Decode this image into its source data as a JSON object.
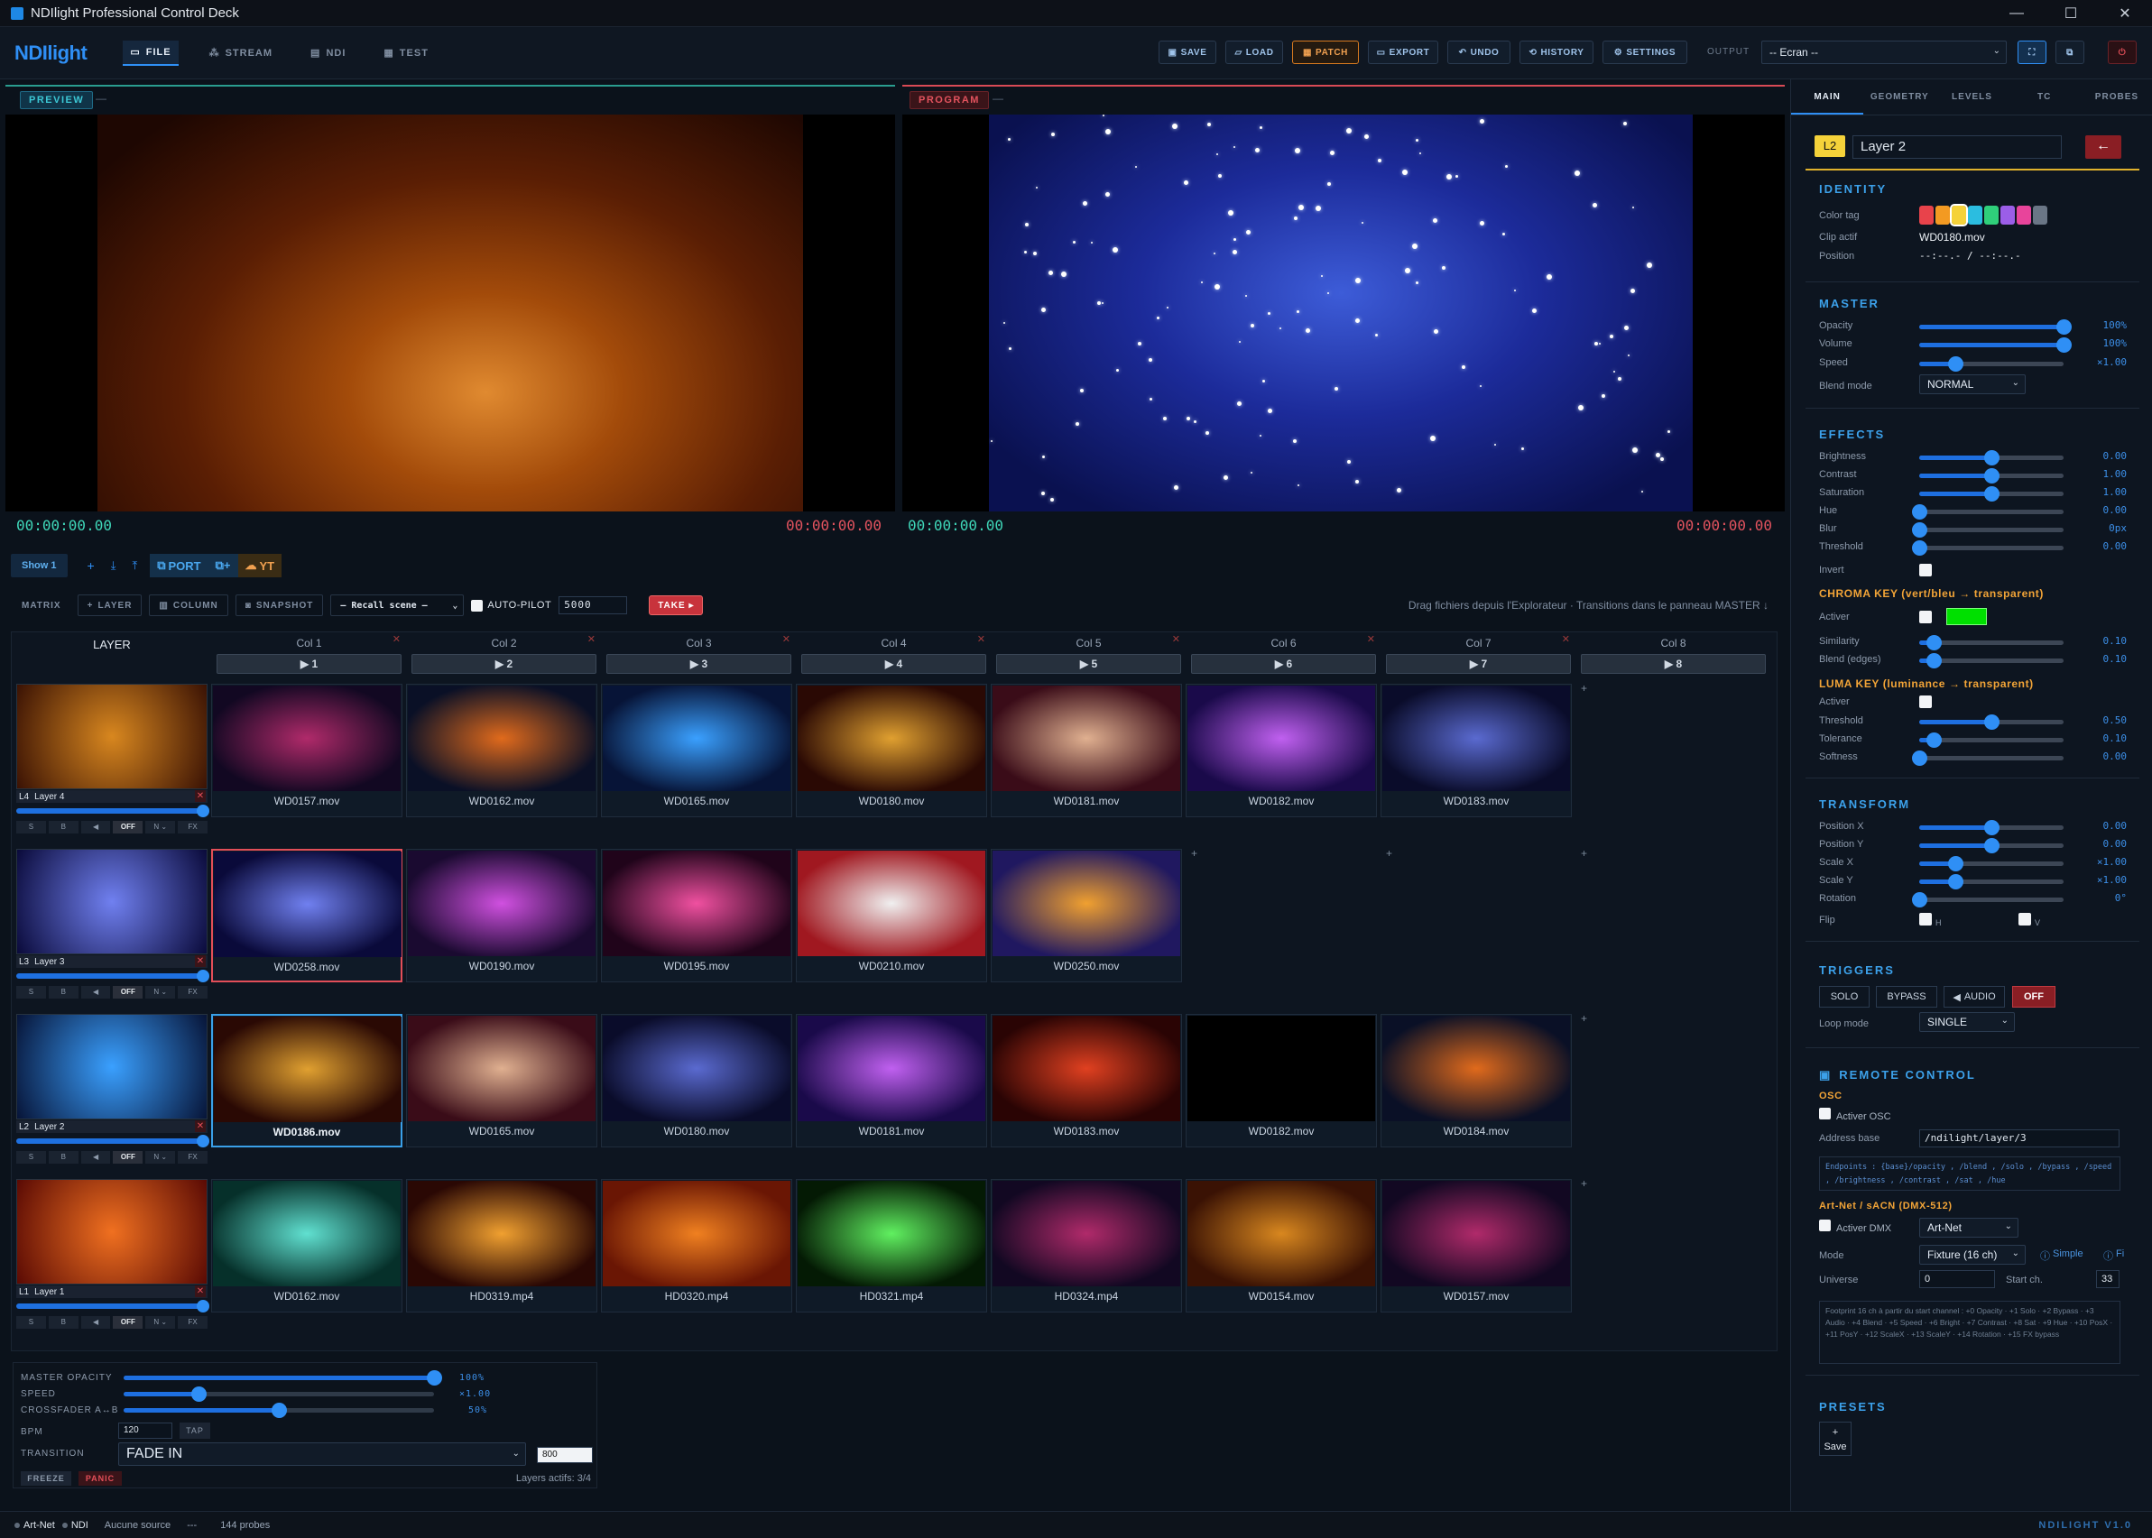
{
  "window": {
    "title": "NDIlight Professional Control Deck"
  },
  "menubar": {
    "logo": "NDIlight",
    "tabs": [
      {
        "label": "FILE",
        "icon": "file-icon"
      },
      {
        "label": "STREAM",
        "icon": "stream-icon"
      },
      {
        "label": "NDI",
        "icon": "ndi-icon"
      },
      {
        "label": "TEST",
        "icon": "test-icon"
      }
    ],
    "tools": [
      "SAVE",
      "LOAD",
      "PATCH",
      "EXPORT",
      "UNDO",
      "HISTORY",
      "SETTINGS"
    ],
    "output_label": "OUTPUT",
    "output_value": "-- Ecran --"
  },
  "preview": {
    "label": "PREVIEW",
    "dash": "—",
    "tc_left": "00:00:00.00",
    "tc_right": "00:00:00.00"
  },
  "program": {
    "label": "PROGRAM",
    "dash": "—",
    "tc_left": "00:00:00.00",
    "tc_right": "00:00:00.00"
  },
  "showbar": {
    "show": "Show 1",
    "port": "PORT",
    "yt": "YT"
  },
  "matrixbar": {
    "title": "MATRIX",
    "layer": "LAYER",
    "column": "COLUMN",
    "snapshot": "SNAPSHOT",
    "recall": "– Recall scene –",
    "autopilot": "AUTO-PILOT",
    "autopilot_value": "5000",
    "take": "TAKE ▸",
    "hint": "Drag fichiers depuis l'Explorateur · Transitions dans le panneau MASTER ↓"
  },
  "grid": {
    "layer_header": "LAYER",
    "columns": [
      {
        "name": "Col 1",
        "play": "▶ 1"
      },
      {
        "name": "Col 2",
        "play": "▶ 2"
      },
      {
        "name": "Col 3",
        "play": "▶ 3"
      },
      {
        "name": "Col 4",
        "play": "▶ 4"
      },
      {
        "name": "Col 5",
        "play": "▶ 5"
      },
      {
        "name": "Col 6",
        "play": "▶ 6"
      },
      {
        "name": "Col 7",
        "play": "▶ 7"
      },
      {
        "name": "Col 8",
        "play": "▶ 8"
      }
    ],
    "layers": [
      {
        "id": "L4",
        "name": "Layer 4",
        "btns": [
          "S",
          "B",
          "◀",
          "OFF",
          "N ⌄",
          "FX"
        ],
        "clips": [
          "WD0157.mov",
          "WD0162.mov",
          "WD0165.mov",
          "WD0180.mov",
          "WD0181.mov",
          "WD0182.mov",
          "WD0183.mov"
        ]
      },
      {
        "id": "L3",
        "name": "Layer 3",
        "btns": [
          "S",
          "B",
          "◀",
          "OFF",
          "N ⌄",
          "FX"
        ],
        "clips": [
          "WD0258.mov",
          "WD0190.mov",
          "WD0195.mov",
          "WD0210.mov",
          "WD0250.mov"
        ]
      },
      {
        "id": "L2",
        "name": "Layer 2",
        "btns": [
          "S",
          "B",
          "◀",
          "OFF",
          "N ⌄",
          "FX"
        ],
        "clips": [
          "WD0186.mov",
          "WD0165.mov",
          "WD0180.mov",
          "WD0181.mov",
          "WD0183.mov",
          "WD0182.mov",
          "WD0184.mov"
        ]
      },
      {
        "id": "L1",
        "name": "Layer 1",
        "btns": [
          "S",
          "B",
          "◀",
          "OFF",
          "N ⌄",
          "FX"
        ],
        "clips": [
          "WD0162.mov",
          "HD0319.mp4",
          "HD0320.mp4",
          "HD0321.mp4",
          "HD0324.mp4",
          "WD0154.mov",
          "WD0157.mov"
        ]
      }
    ]
  },
  "master": {
    "opacity_label": "MASTER OPACITY",
    "opacity_value": "100%",
    "opacity_level": 1.0,
    "speed_label": "SPEED",
    "speed_value": "×1.00",
    "speed_level": 0.24,
    "crossfader_label": "CROSSFADER A↔B",
    "crossfader_value": "50%",
    "crossfader_level": 0.5,
    "bpm_label": "BPM",
    "bpm_value": "120",
    "tap": "TAP",
    "transition_label": "TRANSITION",
    "transition_value": "FADE IN",
    "transition_ms": "800",
    "freeze": "FREEZE",
    "panic": "PANIC",
    "layers_active": "Layers actifs: 3/4"
  },
  "status": {
    "artnet": "Art-Net",
    "ndi": "NDI",
    "source": "Aucune source",
    "sep": "---",
    "probes": "144 probes",
    "version": "NDILIGHT V1.0"
  },
  "panel": {
    "tabs": [
      "MAIN",
      "GEOMETRY",
      "LEVELS",
      "TC",
      "PROBES"
    ],
    "layer_badge": "L2",
    "layer_name": "Layer 2",
    "identity": {
      "title": "IDENTITY",
      "color_tag": "Color tag",
      "clip_label": "Clip actif",
      "clip": "WD0180.mov",
      "position_label": "Position",
      "position": "--:--.- / --:--.-"
    },
    "colors": [
      "#e8434b",
      "#f39a22",
      "#f5d23a",
      "#2bbde0",
      "#2fcf7a",
      "#9b5ee8",
      "#e8449b",
      "#6a7686"
    ],
    "master": {
      "title": "MASTER",
      "opacity": "Opacity",
      "opacity_v": "100%",
      "volume": "Volume",
      "volume_v": "100%",
      "speed": "Speed",
      "speed_v": "×1.00",
      "blend": "Blend mode",
      "blend_v": "NORMAL"
    },
    "effects": {
      "title": "EFFECTS",
      "rows": [
        [
          "Brightness",
          "0.00"
        ],
        [
          "Contrast",
          "1.00"
        ],
        [
          "Saturation",
          "1.00"
        ],
        [
          "Hue",
          "0.00"
        ],
        [
          "Blur",
          "0px"
        ],
        [
          "Threshold",
          "0.00"
        ]
      ],
      "invert": "Invert"
    },
    "chroma": {
      "title": "CHROMA KEY (vert/bleu → transparent)",
      "activer": "Activer",
      "similarity": "Similarity",
      "similarity_v": "0.10",
      "blend": "Blend (edges)",
      "blend_v": "0.10",
      "color": "#00e000"
    },
    "luma": {
      "title": "LUMA KEY (luminance → transparent)",
      "activer": "Activer",
      "threshold": "Threshold",
      "threshold_v": "0.50",
      "tolerance": "Tolerance",
      "tolerance_v": "0.10",
      "softness": "Softness",
      "softness_v": "0.00"
    },
    "transform": {
      "title": "TRANSFORM",
      "rows": [
        [
          "Position X",
          "0.00"
        ],
        [
          "Position Y",
          "0.00"
        ],
        [
          "Scale X",
          "×1.00"
        ],
        [
          "Scale Y",
          "×1.00"
        ],
        [
          "Rotation",
          "0°"
        ]
      ],
      "flip": "Flip",
      "h": "H",
      "v": "V"
    },
    "triggers": {
      "title": "TRIGGERS",
      "solo": "SOLO",
      "bypass": "BYPASS",
      "audio": "AUDIO",
      "off": "OFF",
      "loop": "Loop mode",
      "loop_v": "SINGLE"
    },
    "remote": {
      "title": "REMOTE CONTROL",
      "osc": "OSC",
      "activer_osc": "Activer OSC",
      "address_label": "Address base",
      "address": "/ndilight/layer/3",
      "endpoints": "Endpoints : {base}/opacity , /blend , /solo , /bypass , /speed , /brightness , /contrast , /sat , /hue",
      "artnet_title": "Art-Net / sACN (DMX-512)",
      "activer_dmx": "Activer DMX",
      "dmx_proto": "Art-Net",
      "mode": "Mode",
      "mode_v": "Fixture (16 ch)",
      "simple": "Simple",
      "fi": "Fi",
      "universe": "Universe",
      "universe_v": "0",
      "start": "Start ch.",
      "start_v": "33",
      "footprint": "Footprint 16 ch à partir du start channel : +0 Opacity · +1 Solo · +2 Bypass · +3 Audio · +4 Blend · +5 Speed · +6 Bright · +7 Contrast · +8 Sat · +9 Hue · +10 PosX · +11 PosY · +12 ScaleX · +13 ScaleY · +14 Rotation · +15 FX bypass"
    },
    "presets": {
      "title": "PRESETS",
      "save": "Save"
    }
  }
}
